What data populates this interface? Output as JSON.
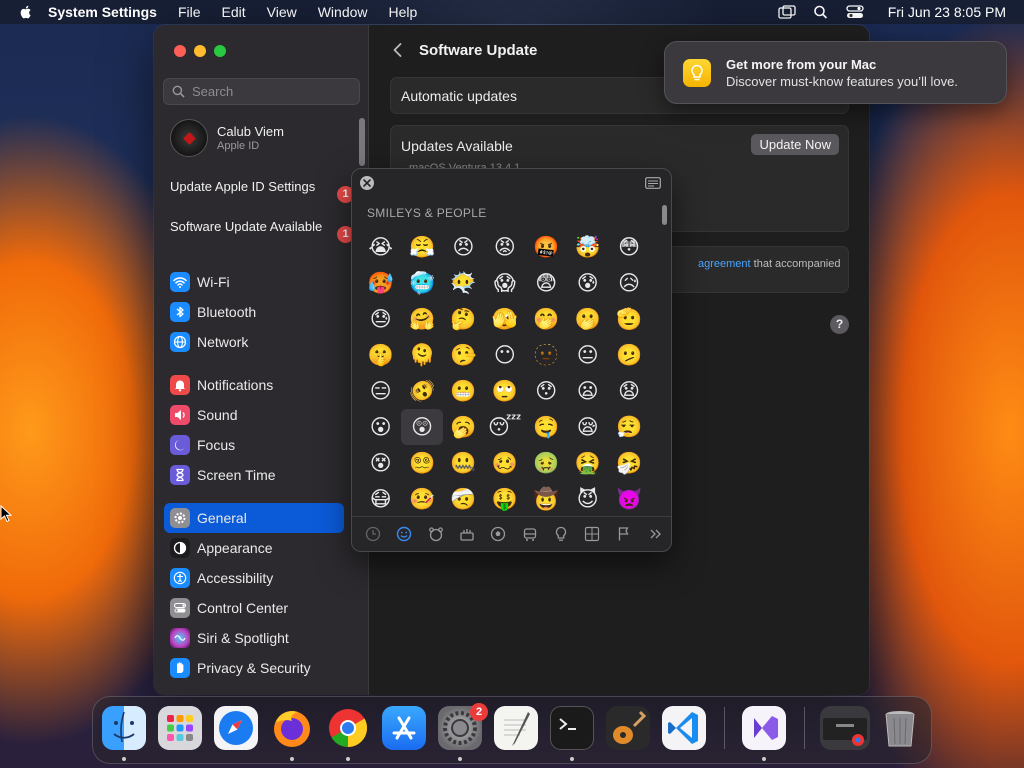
{
  "menubar": {
    "app": "System Settings",
    "items": [
      "File",
      "Edit",
      "View",
      "Window",
      "Help"
    ],
    "clock": "Fri Jun 23  8:05 PM"
  },
  "sidebar": {
    "search_placeholder": "Search",
    "account": {
      "name": "Calub Viem",
      "sub": "Apple ID"
    },
    "alerts": [
      {
        "label": "Update Apple ID Settings",
        "badge": "1"
      },
      {
        "label": "Software Update Available",
        "badge": "1"
      }
    ],
    "items": [
      {
        "label": "Wi-Fi",
        "icon": "wifi-icon",
        "color": "#1a8cff"
      },
      {
        "label": "Bluetooth",
        "icon": "bluetooth-icon",
        "color": "#1a8cff"
      },
      {
        "label": "Network",
        "icon": "globe-icon",
        "color": "#1a8cff"
      },
      {
        "label": "Notifications",
        "icon": "bell-icon",
        "color": "#ee4a4a"
      },
      {
        "label": "Sound",
        "icon": "speaker-icon",
        "color": "#ee4a6a"
      },
      {
        "label": "Focus",
        "icon": "moon-icon",
        "color": "#6a5cd8"
      },
      {
        "label": "Screen Time",
        "icon": "hourglass-icon",
        "color": "#6a5cd8"
      },
      {
        "label": "General",
        "icon": "gear-icon",
        "color": "#8e8e93",
        "selected": true
      },
      {
        "label": "Appearance",
        "icon": "appearance-icon",
        "color": "#1c1c1e"
      },
      {
        "label": "Accessibility",
        "icon": "accessibility-icon",
        "color": "#1a8cff"
      },
      {
        "label": "Control Center",
        "icon": "toggles-icon",
        "color": "#8e8e93"
      },
      {
        "label": "Siri & Spotlight",
        "icon": "siri-icon",
        "color": "#c040c0"
      },
      {
        "label": "Privacy & Security",
        "icon": "hand-icon",
        "color": "#1a8cff"
      }
    ]
  },
  "main": {
    "title": "Software Update",
    "automatic_updates": "Automatic updates",
    "updates_available": "Updates Available",
    "update_now": "Update Now",
    "partial_version": "macOS Ventura 13.4.1",
    "license_link": "agreement",
    "license_rest": " that accompanied",
    "help": "?"
  },
  "notification": {
    "title": "Get more from your Mac",
    "body": "Discover must-know features you’ll love."
  },
  "emoji_picker": {
    "category": "SMILEYS & PEOPLE",
    "emojis": [
      "😭",
      "😤",
      "😠",
      "😡",
      "🤬",
      "🤯",
      "😳",
      "🥵",
      "🥶",
      "😶‍🌫️",
      "😱",
      "😨",
      "😰",
      "😥",
      "😓",
      "🤗",
      "🤔",
      "🫣",
      "🤭",
      "🫢",
      "🫡",
      "🤫",
      "🫠",
      "🤥",
      "😶",
      "🫥",
      "😐",
      "🫤",
      "😑",
      "🫨",
      "😬",
      "🙄",
      "😯",
      "😦",
      "😧",
      "😮",
      "😲",
      "🥱",
      "😴",
      "🤤",
      "😪",
      "😮‍💨",
      "😵",
      "😵‍💫",
      "🤐",
      "🥴",
      "🤢",
      "🤮",
      "🤧",
      "😷",
      "🤒",
      "🤕",
      "🤑",
      "🤠",
      "😈",
      "👿"
    ],
    "hover_index": 36,
    "tabs": [
      "clock-icon",
      "smiley-icon",
      "bear-icon",
      "food-icon",
      "ball-icon",
      "car-icon",
      "bulb-icon",
      "symbols-icon",
      "flag-icon",
      "chevron-right-icon"
    ],
    "active_tab": 1
  },
  "dock": {
    "apps": [
      {
        "name": "finder",
        "color": "#2a8cf0"
      },
      {
        "name": "launchpad",
        "color": "#d8d8dc"
      },
      {
        "name": "safari",
        "color": "#1a7cf0"
      },
      {
        "name": "firefox",
        "color": "#ff7a1a"
      },
      {
        "name": "chrome",
        "color": "#f2f2f2"
      },
      {
        "name": "app-store",
        "color": "#1a8cf8"
      },
      {
        "name": "system-settings",
        "color": "#8a8a8e",
        "badge": "2"
      },
      {
        "name": "textedit",
        "color": "#f4f4f0"
      },
      {
        "name": "terminal",
        "color": "#1a1a1a"
      },
      {
        "name": "garageband",
        "color": "#2a2a2a"
      },
      {
        "name": "vscode",
        "color": "#f4f4f6"
      },
      {
        "name": "visual-studio",
        "color": "#f6f4fa"
      },
      {
        "name": "chrome-window",
        "color": "#3a3a3e"
      },
      {
        "name": "trash",
        "color": "#9a9a9e"
      }
    ]
  }
}
